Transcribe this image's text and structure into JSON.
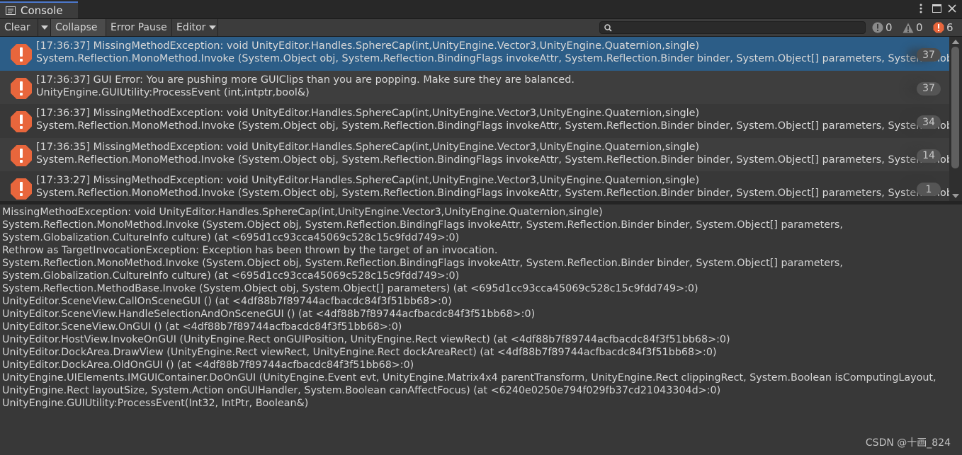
{
  "window": {
    "tab_title": "Console"
  },
  "toolbar": {
    "clear_label": "Clear",
    "collapse_label": "Collapse",
    "error_pause_label": "Error Pause",
    "editor_label": "Editor",
    "search_placeholder": "",
    "counts": {
      "info": "0",
      "warning": "0",
      "error": "6"
    }
  },
  "entries": [
    {
      "line1": "[17:36:37] MissingMethodException: void UnityEditor.Handles.SphereCap(int,UnityEngine.Vector3,UnityEngine.Quaternion,single)",
      "line2": "System.Reflection.MonoMethod.Invoke (System.Object obj, System.Reflection.BindingFlags invokeAttr, System.Reflection.Binder binder, System.Object[] parameters, System.Globa",
      "count": "37"
    },
    {
      "line1": "[17:36:37] GUI Error: You are pushing more GUIClips than you are popping. Make sure they are balanced.",
      "line2": "UnityEngine.GUIUtility:ProcessEvent (int,intptr,bool&)",
      "count": "37"
    },
    {
      "line1": "[17:36:37] MissingMethodException: void UnityEditor.Handles.SphereCap(int,UnityEngine.Vector3,UnityEngine.Quaternion,single)",
      "line2": "System.Reflection.MonoMethod.Invoke (System.Object obj, System.Reflection.BindingFlags invokeAttr, System.Reflection.Binder binder, System.Object[] parameters, System.Globa",
      "count": "34"
    },
    {
      "line1": "[17:36:35] MissingMethodException: void UnityEditor.Handles.SphereCap(int,UnityEngine.Vector3,UnityEngine.Quaternion,single)",
      "line2": "System.Reflection.MonoMethod.Invoke (System.Object obj, System.Reflection.BindingFlags invokeAttr, System.Reflection.Binder binder, System.Object[] parameters, System.Globa",
      "count": "14"
    },
    {
      "line1": "[17:33:27] MissingMethodException: void UnityEditor.Handles.SphereCap(int,UnityEngine.Vector3,UnityEngine.Quaternion,single)",
      "line2": "System.Reflection.MonoMethod.Invoke (System.Object obj, System.Reflection.BindingFlags invokeAttr, System.Reflection.Binder binder, System.Object[] parameters, System.Globa",
      "count": "1"
    }
  ],
  "detail_lines": [
    "MissingMethodException: void UnityEditor.Handles.SphereCap(int,UnityEngine.Vector3,UnityEngine.Quaternion,single)",
    "System.Reflection.MonoMethod.Invoke (System.Object obj, System.Reflection.BindingFlags invokeAttr, System.Reflection.Binder binder, System.Object[] parameters,",
    "System.Globalization.CultureInfo culture) (at <695d1cc93cca45069c528c15c9fdd749>:0)",
    "Rethrow as TargetInvocationException: Exception has been thrown by the target of an invocation.",
    "System.Reflection.MonoMethod.Invoke (System.Object obj, System.Reflection.BindingFlags invokeAttr, System.Reflection.Binder binder, System.Object[] parameters,",
    "System.Globalization.CultureInfo culture) (at <695d1cc93cca45069c528c15c9fdd749>:0)",
    "System.Reflection.MethodBase.Invoke (System.Object obj, System.Object[] parameters) (at <695d1cc93cca45069c528c15c9fdd749>:0)",
    "UnityEditor.SceneView.CallOnSceneGUI () (at <4df88b7f89744acfbacdc84f3f51bb68>:0)",
    "UnityEditor.SceneView.HandleSelectionAndOnSceneGUI () (at <4df88b7f89744acfbacdc84f3f51bb68>:0)",
    "UnityEditor.SceneView.OnGUI () (at <4df88b7f89744acfbacdc84f3f51bb68>:0)",
    "UnityEditor.HostView.InvokeOnGUI (UnityEngine.Rect onGUIPosition, UnityEngine.Rect viewRect) (at <4df88b7f89744acfbacdc84f3f51bb68>:0)",
    "UnityEditor.DockArea.DrawView (UnityEngine.Rect viewRect, UnityEngine.Rect dockAreaRect) (at <4df88b7f89744acfbacdc84f3f51bb68>:0)",
    "UnityEditor.DockArea.OldOnGUI () (at <4df88b7f89744acfbacdc84f3f51bb68>:0)",
    "UnityEngine.UIElements.IMGUIContainer.DoOnGUI (UnityEngine.Event evt, UnityEngine.Matrix4x4 parentTransform, UnityEngine.Rect clippingRect, System.Boolean isComputingLayout,",
    "UnityEngine.Rect layoutSize, System.Action onGUIHandler, System.Boolean canAffectFocus) (at <6240e0250e794f029fb37cd21043304d>:0)",
    "UnityEngine.GUIUtility:ProcessEvent(Int32, IntPtr, Boolean&)"
  ],
  "watermark": "CSDN @十画_824",
  "colors": {
    "selection": "#2c5d87",
    "error_icon": "#e8663c",
    "tab_accent": "#4d78cc"
  },
  "icons": {
    "tab": "console-icon",
    "row": "error-icon",
    "search": "search-icon"
  }
}
